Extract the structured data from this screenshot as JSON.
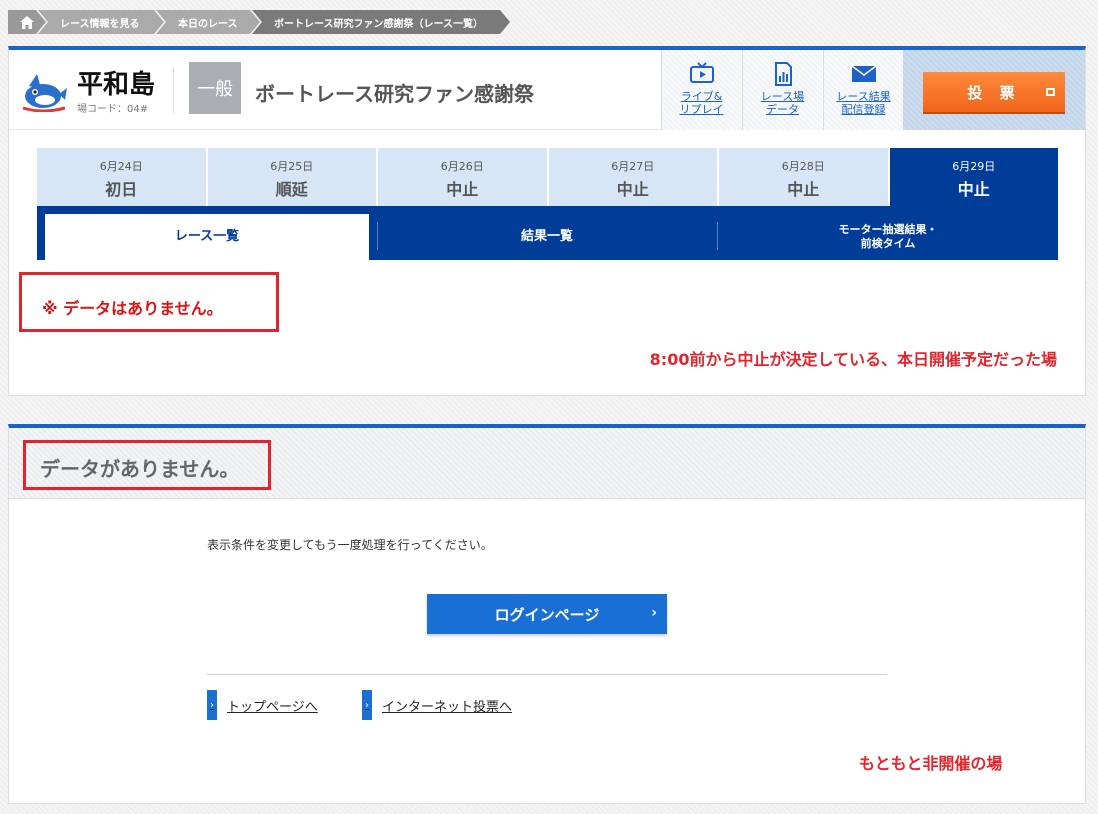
{
  "breadcrumb": {
    "items": [
      "レース情報を見る",
      "本日のレース",
      "ボートレース研究ファン感謝祭（レース一覧）"
    ]
  },
  "stadium": {
    "name": "平和島",
    "code": "場コード：04#",
    "grade": "一般",
    "race_title": "ボートレース研究ファン感謝祭"
  },
  "quick_links": [
    {
      "label": "ライブ&\nリプレイ",
      "icon": "tv-icon"
    },
    {
      "label": "レース場\nデータ",
      "icon": "document-chart-icon"
    },
    {
      "label": "レース結果\n配信登録",
      "icon": "mail-icon"
    }
  ],
  "vote_button": "投 票",
  "days": [
    {
      "date": "6月24日",
      "status": "初日"
    },
    {
      "date": "6月25日",
      "status": "順延"
    },
    {
      "date": "6月26日",
      "status": "中止"
    },
    {
      "date": "6月27日",
      "status": "中止"
    },
    {
      "date": "6月28日",
      "status": "中止"
    },
    {
      "date": "6月29日",
      "status": "中止"
    }
  ],
  "tabs": {
    "race_list": "レース一覧",
    "results": "結果一覧",
    "motor": "モーター抽選結果・\n前検タイム"
  },
  "panel1": {
    "no_data": "※ データはありません。",
    "annotation": "8:00前から中止が決定している、本日開催予定だった場"
  },
  "panel2": {
    "heading": "データがありません。",
    "message": "表示条件を変更してもう一度処理を行ってください。",
    "login_button": "ログインページ",
    "links": [
      "トップページへ",
      "インターネット投票へ"
    ],
    "annotation": "もともと非開催の場"
  },
  "colors": {
    "primary": "#1b63c8",
    "navy": "#003d99",
    "vote": "#f0641a",
    "annotation": "#e0262c"
  }
}
